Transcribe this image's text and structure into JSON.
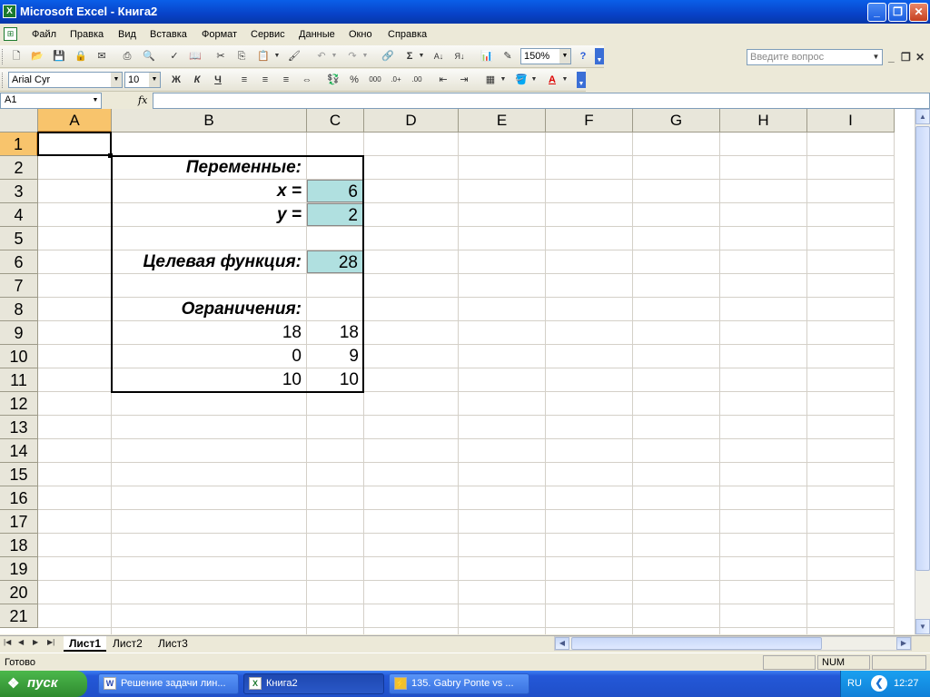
{
  "window": {
    "title": "Microsoft Excel - Книга2"
  },
  "menu": {
    "items": [
      "Файл",
      "Правка",
      "Вид",
      "Вставка",
      "Формат",
      "Сервис",
      "Данные",
      "Окно",
      "Справка"
    ],
    "ask_placeholder": "Введите вопрос"
  },
  "toolbar": {
    "zoom": "150%",
    "font_name": "Arial Cyr",
    "font_size": "10"
  },
  "formula": {
    "name_box": "A1",
    "fx": "fx",
    "value": ""
  },
  "columns": [
    "A",
    "B",
    "C",
    "D",
    "E",
    "F",
    "G",
    "H",
    "I"
  ],
  "rows": [
    "1",
    "2",
    "3",
    "4",
    "5",
    "6",
    "7",
    "8",
    "9",
    "10",
    "11",
    "12",
    "13",
    "14",
    "15",
    "16",
    "17",
    "18",
    "19",
    "20",
    "21"
  ],
  "cells": {
    "b2": "Переменные:",
    "b3": "x =",
    "c3": "6",
    "b4": "y =",
    "c4": "2",
    "b6": "Целевая функция:",
    "c6": "28",
    "b8": "Ограничения:",
    "b9": "18",
    "c9": "18",
    "b10": "0",
    "c10": "9",
    "b11": "10",
    "c11": "10"
  },
  "sheets": [
    "Лист1",
    "Лист2",
    "Лист3"
  ],
  "status": {
    "text": "Готово",
    "num": "NUM"
  },
  "taskbar": {
    "start": "пуск",
    "tasks": [
      "Решение задачи лин...",
      "Книга2",
      "135. Gabry Ponte vs ..."
    ],
    "lang": "RU",
    "time": "12:27"
  },
  "colors": {
    "accent": "#0a5fe8",
    "selected_header": "#f8c46c",
    "input_cell": "#b0e0e0",
    "start_green": "#2e8a2e"
  }
}
